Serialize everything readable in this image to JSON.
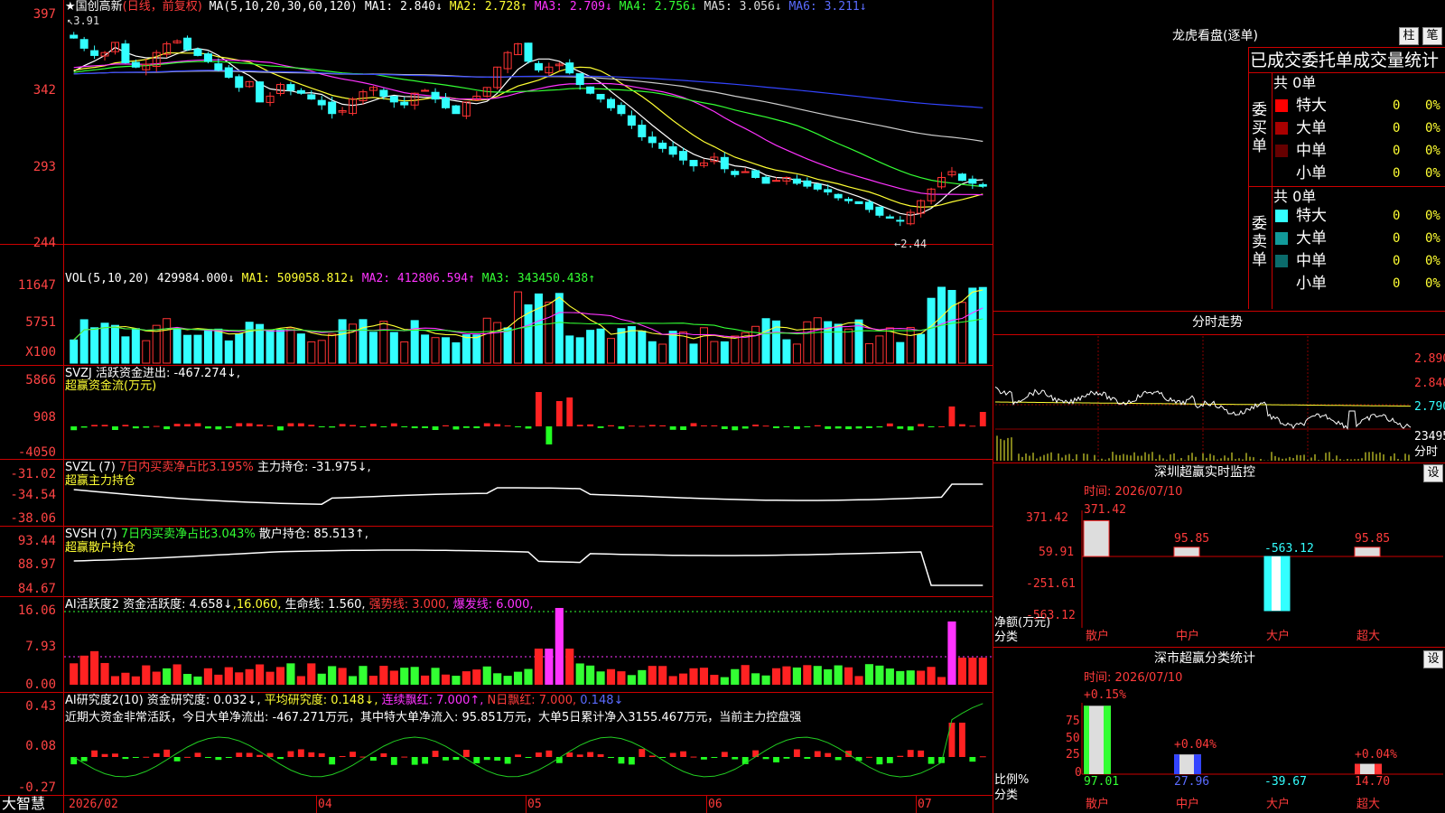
{
  "header": {
    "stock_name": "★国创高新",
    "period": "(日线，前复权)",
    "ma_label": "MA(5,10,20,30,60,120)",
    "ma1": "MA1: 2.840↓",
    "ma2": "MA2: 2.728↑",
    "ma3": "MA3: 2.709↓",
    "ma4": "MA4: 2.756↓",
    "ma5": "MA5: 3.056↓",
    "ma6": "MA6: 3.211↓",
    "high_mark": "3.91",
    "low_mark": "2.44"
  },
  "axes": {
    "price": [
      "397",
      "342",
      "293",
      "244"
    ],
    "vol": [
      "11647",
      "5751",
      "X100"
    ],
    "svzj": [
      "5866",
      "908",
      "-4050"
    ],
    "svzl": [
      "-31.02",
      "-34.54",
      "-38.06"
    ],
    "svsh": [
      "93.44",
      "88.97",
      "84.67"
    ],
    "ai1": [
      "16.06",
      "7.93",
      "0.00"
    ],
    "ai2": [
      "0.43",
      "0.08",
      "-0.27"
    ]
  },
  "vol_header": {
    "label": "VOL(5,10,20)",
    "value": "429984.000↓",
    "ma1": "MA1: 509058.812↓",
    "ma2": "MA2: 412806.594↑",
    "ma3": "MA3: 343450.438↑"
  },
  "svzj_header": {
    "label": "SVZJ  活跃资金进出: -467.274↓,",
    "sub": "超赢资金流(万元)"
  },
  "svzl_header": {
    "label": "SVZL (7)",
    "ratio": "7日内买卖净占比3.195%",
    "pos": "主力持仓: -31.975↓,",
    "sub": "超赢主力持仓"
  },
  "svsh_header": {
    "label": "SVSH (7)",
    "ratio": "7日内买卖净占比3.043%",
    "pos": "散户持仓: 85.513↑,",
    "sub": "超赢散户持仓"
  },
  "ai1_header": {
    "label": "AI活跃度2",
    "a": "资金活跃度: 4.658↓",
    "b": ",16.060,",
    "c": "生命线: 1.560,",
    "d": "强势线: 3.000,",
    "e": "爆发线: 6.000,"
  },
  "ai2_header": {
    "label": "AI研究度2(10)",
    "a": "资金研究度: 0.032↓,",
    "b": "平均研究度: 0.148↓,",
    "c": "连续飘红: 7.000↑,",
    "d": "N日飘红: 7.000,",
    "e": "0.148↓",
    "comment": "近期大资金非常活跃，今日大单净流出: -467.271万元，其中特大单净流入: 95.851万元，大单5日累计净入3155.467万元，当前主力控盘强"
  },
  "bottom_axis": {
    "brand": "大智慧",
    "dates": [
      "2026/02",
      "04",
      "05",
      "06",
      "07"
    ]
  },
  "right": {
    "dragon_title": "龙虎看盘(逐单)",
    "btn_zhu": "柱",
    "btn_bi": "笔",
    "stats_title": "已成交委托单成交量统计",
    "buy_label": "委买单",
    "sell_label": "委卖单",
    "buy_total": "共 0单",
    "sell_total": "共 0单",
    "buy_rows": [
      {
        "name": "特大",
        "count": "0",
        "pct": "0%",
        "color": "#ff0000"
      },
      {
        "name": "大单",
        "count": "0",
        "pct": "0%",
        "color": "#aa0000"
      },
      {
        "name": "中单",
        "count": "0",
        "pct": "0%",
        "color": "#660000"
      },
      {
        "name": "小单",
        "count": "0",
        "pct": "0%",
        "color": ""
      }
    ],
    "sell_rows": [
      {
        "name": "特大",
        "count": "0",
        "pct": "0%",
        "color": "#33ffff"
      },
      {
        "name": "大单",
        "count": "0",
        "pct": "0%",
        "color": "#129a9a"
      },
      {
        "name": "中单",
        "count": "0",
        "pct": "0%",
        "color": "#0b6b6b"
      },
      {
        "name": "小单",
        "count": "0",
        "pct": "0%",
        "color": ""
      }
    ],
    "fenshi_title": "分时走势",
    "fenshi_axis": [
      "2.890",
      "2.840",
      "2.790",
      "23495",
      "分时"
    ],
    "sz_title": "深圳超赢实时监控",
    "sz_btn": "设",
    "sz_time": "时间: 2026/07/10",
    "sz_axis": [
      "371.42",
      "59.91",
      "-251.61",
      "-563.12"
    ],
    "sz_values": [
      "371.42",
      "95.85",
      "-563.12",
      "95.85"
    ],
    "sz_xlabel1": "净额(万元)",
    "sz_xlabel2": "分类",
    "sz_cats": [
      "散户",
      "中户",
      "大户",
      "超大"
    ],
    "sc_title": "深市超赢分类统计",
    "sc_btn": "设",
    "sc_time": "时间: 2026/07/10",
    "sc_axis": [
      "75",
      "50",
      "25",
      "0"
    ],
    "sc_top": [
      "+0.15%",
      "+0.04%",
      "+0.04%"
    ],
    "sc_values": [
      "97.01",
      "27.96",
      "-39.67",
      "14.70"
    ],
    "sc_xlabel1": "比例%",
    "sc_xlabel2": "分类",
    "sc_cats": [
      "散户",
      "中户",
      "大户",
      "超大"
    ]
  },
  "chart_data": {
    "type": "candlestick",
    "title": "国创高新 (日线，前复权)",
    "ylim": [
      2.44,
      3.97
    ],
    "x_start": "2026/02",
    "ohlc_close_approx": [
      3.82,
      3.75,
      3.7,
      3.72,
      3.79,
      3.65,
      3.62,
      3.64,
      3.72,
      3.78,
      3.8,
      3.74,
      3.7,
      3.66,
      3.6,
      3.55,
      3.48,
      3.52,
      3.38,
      3.42,
      3.5,
      3.46,
      3.44,
      3.4,
      3.36,
      3.3,
      3.32,
      3.4,
      3.45,
      3.48,
      3.42,
      3.38,
      3.36,
      3.44,
      3.46,
      3.4,
      3.34,
      3.3,
      3.38,
      3.42,
      3.48,
      3.62,
      3.72,
      3.78,
      3.66,
      3.6,
      3.62,
      3.64,
      3.58,
      3.5,
      3.44,
      3.4,
      3.34,
      3.3,
      3.22,
      3.14,
      3.1,
      3.06,
      3.02,
      2.98,
      2.94,
      2.96,
      3.0,
      2.92,
      2.88,
      2.9,
      2.86,
      2.82,
      2.84,
      2.86,
      2.82,
      2.8,
      2.78,
      2.76,
      2.72,
      2.7,
      2.68,
      2.64,
      2.6,
      2.58,
      2.56,
      2.62,
      2.7,
      2.78,
      2.86,
      2.9,
      2.84,
      2.82,
      2.8
    ],
    "vol_series": [
      {
        "name": "MA1",
        "value": 509058.812
      },
      {
        "name": "MA2",
        "value": 412806.594
      },
      {
        "name": "MA3",
        "value": 343450.438
      }
    ]
  }
}
